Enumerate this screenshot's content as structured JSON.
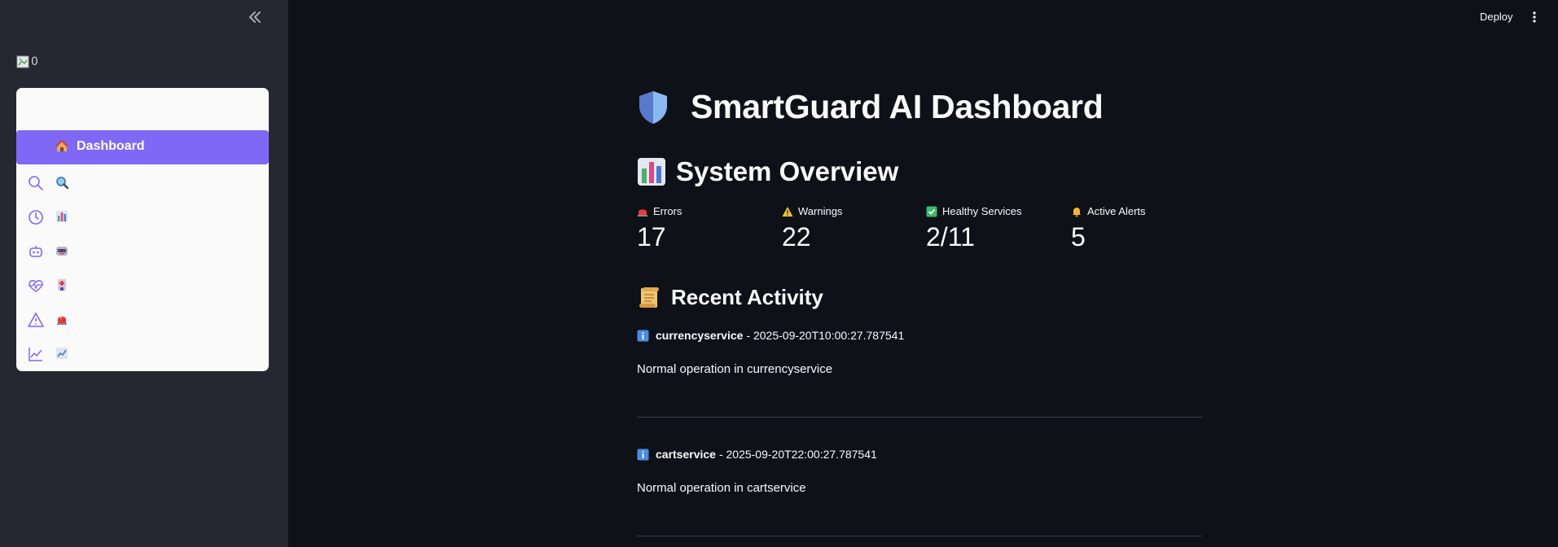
{
  "sidebar": {
    "broken_image_alt": "0",
    "nav": [
      {
        "label": "Dashboard",
        "lead_icon": "none",
        "emoji": "house-icon",
        "active": true
      },
      {
        "label": "",
        "lead_icon": "search-icon",
        "emoji": "magnifier-emoji-icon",
        "active": false
      },
      {
        "label": "",
        "lead_icon": "history-icon",
        "emoji": "bar-chart-emoji-icon",
        "active": false
      },
      {
        "label": "",
        "lead_icon": "robot-icon",
        "emoji": "robot-emoji-icon",
        "active": false
      },
      {
        "label": "",
        "lead_icon": "heart-pulse-icon",
        "emoji": "hospital-emoji-icon",
        "active": false
      },
      {
        "label": "",
        "lead_icon": "warning-icon",
        "emoji": "siren-emoji-icon",
        "active": false
      },
      {
        "label": "",
        "lead_icon": "line-chart-icon",
        "emoji": "trend-emoji-icon",
        "active": false
      }
    ]
  },
  "header": {
    "deploy_label": "Deploy"
  },
  "main": {
    "title": "SmartGuard AI Dashboard",
    "overview_heading": "System Overview",
    "metrics": [
      {
        "label": "Errors",
        "value": "17",
        "icon": "siren-icon"
      },
      {
        "label": "Warnings",
        "value": "22",
        "icon": "warning-icon"
      },
      {
        "label": "Healthy Services",
        "value": "2/11",
        "icon": "check-icon"
      },
      {
        "label": "Active Alerts",
        "value": "5",
        "icon": "bell-icon"
      }
    ],
    "activity_heading": "Recent Activity",
    "activities": [
      {
        "service": "currencyservice",
        "timestamp": "- 2025-09-20T10:00:27.787541",
        "message": "Normal operation in currencyservice"
      },
      {
        "service": "cartservice",
        "timestamp": "- 2025-09-20T22:00:27.787541",
        "message": "Normal operation in cartservice"
      }
    ]
  },
  "colors": {
    "accent": "#8068f6",
    "background": "#0e1117",
    "sidebar": "#262730",
    "nav_card": "#fafafa"
  }
}
